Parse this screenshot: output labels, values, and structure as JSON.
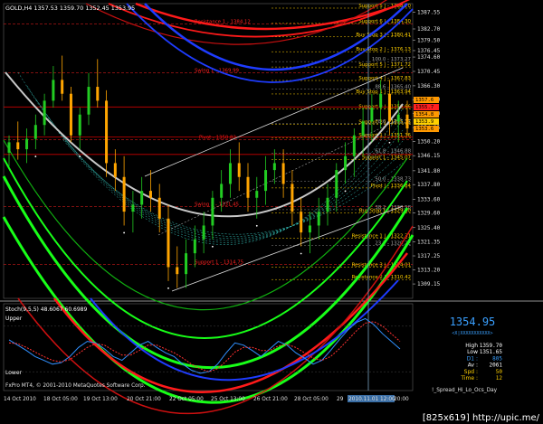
{
  "chart_header": {
    "symbol_line": "GOLD,H4  1357.53 1359.70 1352.45 1353.95",
    "type_note": "candlestick"
  },
  "chart_data": [
    {
      "type": "line",
      "panel": "main-price",
      "candles": [
        [
          1347,
          1352,
          1343,
          1350
        ],
        [
          1350,
          1356,
          1345,
          1348
        ],
        [
          1348,
          1354,
          1344,
          1351
        ],
        [
          1351,
          1358,
          1348,
          1355
        ],
        [
          1355,
          1364,
          1352,
          1362
        ],
        [
          1362,
          1372,
          1360,
          1368
        ],
        [
          1368,
          1375,
          1362,
          1364
        ],
        [
          1364,
          1366,
          1350,
          1352
        ],
        [
          1352,
          1360,
          1348,
          1358
        ],
        [
          1358,
          1370,
          1355,
          1366
        ],
        [
          1366,
          1374,
          1360,
          1362
        ],
        [
          1362,
          1365,
          1340,
          1344
        ],
        [
          1344,
          1348,
          1336,
          1340
        ],
        [
          1340,
          1346,
          1326,
          1330
        ],
        [
          1330,
          1336,
          1324,
          1332
        ],
        [
          1332,
          1340,
          1328,
          1336
        ],
        [
          1336,
          1342,
          1330,
          1334
        ],
        [
          1334,
          1338,
          1324,
          1328
        ],
        [
          1328,
          1332,
          1310,
          1314
        ],
        [
          1314,
          1320,
          1308,
          1312
        ],
        [
          1312,
          1322,
          1308,
          1318
        ],
        [
          1318,
          1326,
          1314,
          1322
        ],
        [
          1322,
          1330,
          1318,
          1326
        ],
        [
          1326,
          1336,
          1322,
          1334
        ],
        [
          1334,
          1342,
          1330,
          1338
        ],
        [
          1338,
          1348,
          1334,
          1344
        ],
        [
          1344,
          1350,
          1336,
          1340
        ],
        [
          1340,
          1344,
          1330,
          1334
        ],
        [
          1334,
          1340,
          1328,
          1336
        ],
        [
          1336,
          1346,
          1332,
          1342
        ],
        [
          1342,
          1348,
          1338,
          1344
        ],
        [
          1344,
          1348,
          1334,
          1338
        ],
        [
          1338,
          1342,
          1326,
          1330
        ],
        [
          1330,
          1334,
          1320,
          1324
        ],
        [
          1324,
          1330,
          1318,
          1326
        ],
        [
          1326,
          1334,
          1322,
          1330
        ],
        [
          1330,
          1338,
          1326,
          1334
        ],
        [
          1334,
          1344,
          1330,
          1342
        ],
        [
          1342,
          1350,
          1338,
          1346
        ],
        [
          1346,
          1354,
          1340,
          1352
        ],
        [
          1352,
          1360,
          1346,
          1356
        ],
        [
          1356,
          1364,
          1350,
          1360
        ],
        [
          1360,
          1368,
          1354,
          1364
        ],
        [
          1364,
          1368,
          1352,
          1356
        ],
        [
          1356,
          1362,
          1350,
          1358
        ],
        [
          1358,
          1362,
          1352,
          1354
        ]
      ],
      "x_tick_labels": [
        "14 Oct 2010",
        "18 Oct 05:00",
        "19 Oct 13:00",
        "20 Oct 21:00",
        "22 Oct 05:00",
        "25 Oct 13:00",
        "26 Oct 21:00",
        "28 Oct 05:00",
        "29",
        "2010.11.01 12:00",
        "20:00"
      ],
      "y_tick_labels": [
        "1387.55",
        "1382.70",
        "1379.50",
        "1376.45",
        "1374.60",
        "1370.45",
        "1366.30",
        "1362.30",
        "1358.30",
        "1354.25",
        "1350.20",
        "1346.15",
        "1341.80",
        "1337.80",
        "1333.60",
        "1329.60",
        "1325.40",
        "1321.35",
        "1317.25",
        "1313.20",
        "1309.15"
      ],
      "ylim": [
        1305,
        1390
      ],
      "current_price_labels": [
        "1357.6",
        "1355.7",
        "1354.8",
        "1353.9",
        "1353.6"
      ],
      "level_labels": [
        {
          "text": "Resistance 1 - 1384.12",
          "price": 1384.12,
          "color": "#ff2020"
        },
        {
          "text": "Swing 1 - 1369.99",
          "price": 1369.99,
          "color": "#ff2020"
        },
        {
          "text": "Pivot - 1350.82",
          "price": 1350.82,
          "color": "#ff2020"
        },
        {
          "text": "Swing 2 - 1331.45",
          "price": 1331.45,
          "color": "#ff2020"
        },
        {
          "text": "Support 1 - 1314.75",
          "price": 1314.75,
          "color": "#ff2020"
        },
        {
          "text": "Support 5 | - 1388.70",
          "price": 1388.7,
          "color": "#ffd000"
        },
        {
          "text": "Support 6 | - 1384.30",
          "price": 1384.3,
          "color": "#ffd000"
        },
        {
          "text": "Buy Stop 3 | - 1380.41",
          "price": 1380.41,
          "color": "#ffd000"
        },
        {
          "text": "Buy Stop 2 | - 1376.13",
          "price": 1376.13,
          "color": "#ffd000"
        },
        {
          "text": "100.0 - 1373.27",
          "price": 1373.27,
          "color": "#a0a0a0"
        },
        {
          "text": "Support 5 | - 1371.72",
          "price": 1371.72,
          "color": "#ffd000"
        },
        {
          "text": "Support 4 | - 1367.83",
          "price": 1367.83,
          "color": "#ffd000"
        },
        {
          "text": "88.6 - 1365.40",
          "price": 1365.4,
          "color": "#a0a0a0"
        },
        {
          "text": "Buy Stop 1 | - 1363.94",
          "price": 1363.94,
          "color": "#ffd000"
        },
        {
          "text": "Support 3 | - 1359.66",
          "price": 1359.66,
          "color": "#ffd000"
        },
        {
          "text": "78.6 - 1355.37",
          "price": 1355.37,
          "color": "#a0a0a0"
        },
        {
          "text": "Support 2 | - 1355.25",
          "price": 1355.25,
          "color": "#ffd000"
        },
        {
          "text": "Support 1 | - 1351.36",
          "price": 1351.36,
          "color": "#ffd000"
        },
        {
          "text": "61.8 - 1346.88",
          "price": 1346.88,
          "color": "#a0a0a0"
        },
        {
          "text": "Support 1 - 1345.07",
          "price": 1345.07,
          "color": "#ffd000"
        },
        {
          "text": "50.0 - 1338.73",
          "price": 1338.73,
          "color": "#a0a0a0"
        },
        {
          "text": "Pivot | - 1336.84",
          "price": 1336.84,
          "color": "#ffd000"
        },
        {
          "text": "38.2 - 1330.58",
          "price": 1330.58,
          "color": "#a0a0a0"
        },
        {
          "text": "Buy Stop 1 - 1329.60",
          "price": 1329.6,
          "color": "#ffd000"
        },
        {
          "text": "Resistance 1 | - 1322.31",
          "price": 1322.31,
          "color": "#ffd000"
        },
        {
          "text": "23.2 - 1320.22",
          "price": 1320.22,
          "color": "#a0a0a0"
        },
        {
          "text": "Resistance 2 | - 1310.42",
          "price": 1310.42,
          "color": "#ffd000"
        },
        {
          "text": "Resistance 3 | - 1314.01",
          "price": 1314.01,
          "color": "#ffd000"
        }
      ],
      "colors": {
        "bull": "#22cc22",
        "bear": "#ffa500",
        "ma": "#c8c8c8",
        "red_arc": "#ff1a1a",
        "blue_arc": "#1e3cff",
        "green_arc": "#18ff18"
      }
    },
    {
      "type": "line",
      "panel": "stochastic",
      "title": "Stoch(9,5,5) 48.6067 60.6989",
      "series": [
        {
          "name": "%K",
          "color": "#3090ff",
          "values": [
            62,
            55,
            48,
            40,
            35,
            30,
            32,
            40,
            52,
            60,
            58,
            50,
            40,
            35,
            45,
            55,
            60,
            52,
            45,
            40,
            30,
            22,
            18,
            20,
            30,
            45,
            58,
            55,
            48,
            40,
            50,
            60,
            55,
            45,
            38,
            30,
            35,
            48,
            62,
            75,
            85,
            90,
            82,
            70,
            60,
            50
          ]
        },
        {
          "name": "%D",
          "color": "#ff3030",
          "values": [
            58,
            57,
            52,
            46,
            40,
            35,
            33,
            36,
            44,
            52,
            57,
            55,
            48,
            42,
            42,
            48,
            55,
            55,
            50,
            45,
            38,
            30,
            24,
            20,
            24,
            34,
            46,
            52,
            52,
            48,
            48,
            54,
            56,
            52,
            45,
            38,
            35,
            40,
            50,
            62,
            74,
            84,
            86,
            80,
            70,
            60
          ]
        }
      ],
      "labels": {
        "upper": "Upper",
        "lower": "Lower"
      }
    }
  ],
  "info_box": {
    "big_price": "1354.95",
    "dash_line": "<X|XXXXXXXXXXX>",
    "rows": [
      {
        "k": "High",
        "v": "1359.70"
      },
      {
        "k": "Low",
        "v": "1351.65"
      },
      {
        "k": "D1 :",
        "v": "805"
      },
      {
        "k": "Av :",
        "v": "2061"
      },
      {
        "k": "Spd :",
        "v": "50"
      },
      {
        "k": "Time :",
        "v": "12"
      }
    ]
  },
  "footer": {
    "copyright": "FxPro MT4, © 2001-2010 MetaQuotes Software Corp.",
    "indicator_label": "!_Spread_Hi_Lo_Ocs_Day",
    "brand": "",
    "vertical_marker_date": "2010.11.01 12:00"
  },
  "watermark": "[825x619] http://upic.me/"
}
